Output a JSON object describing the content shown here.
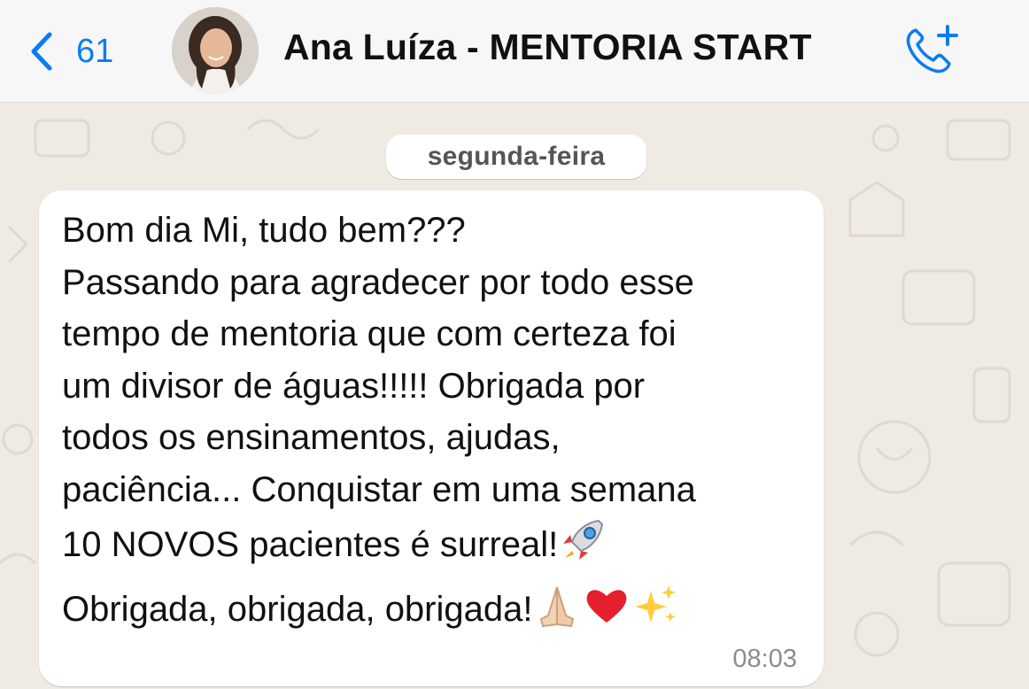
{
  "header": {
    "back_count": "61",
    "contact_name": "Ana Luíza - MENTORIA START",
    "accent_color": "#0a7cf6"
  },
  "chat": {
    "date_separator": "segunda-feira",
    "message": {
      "lines": [
        "Bom dia Mi, tudo bem???",
        "Passando para agradecer por todo esse",
        "tempo de mentoria que com certeza foi",
        "um divisor de águas!!!!! Obrigada por",
        "todos os ensinamentos, ajudas,",
        "paciência... Conquistar em uma semana",
        "10 NOVOS pacientes é surreal!",
        "Obrigada, obrigada, obrigada!"
      ],
      "emojis": [
        "rocket-emoji",
        "folded-hands-emoji",
        "red-heart-emoji",
        "sparkles-emoji"
      ],
      "time": "08:03"
    }
  }
}
